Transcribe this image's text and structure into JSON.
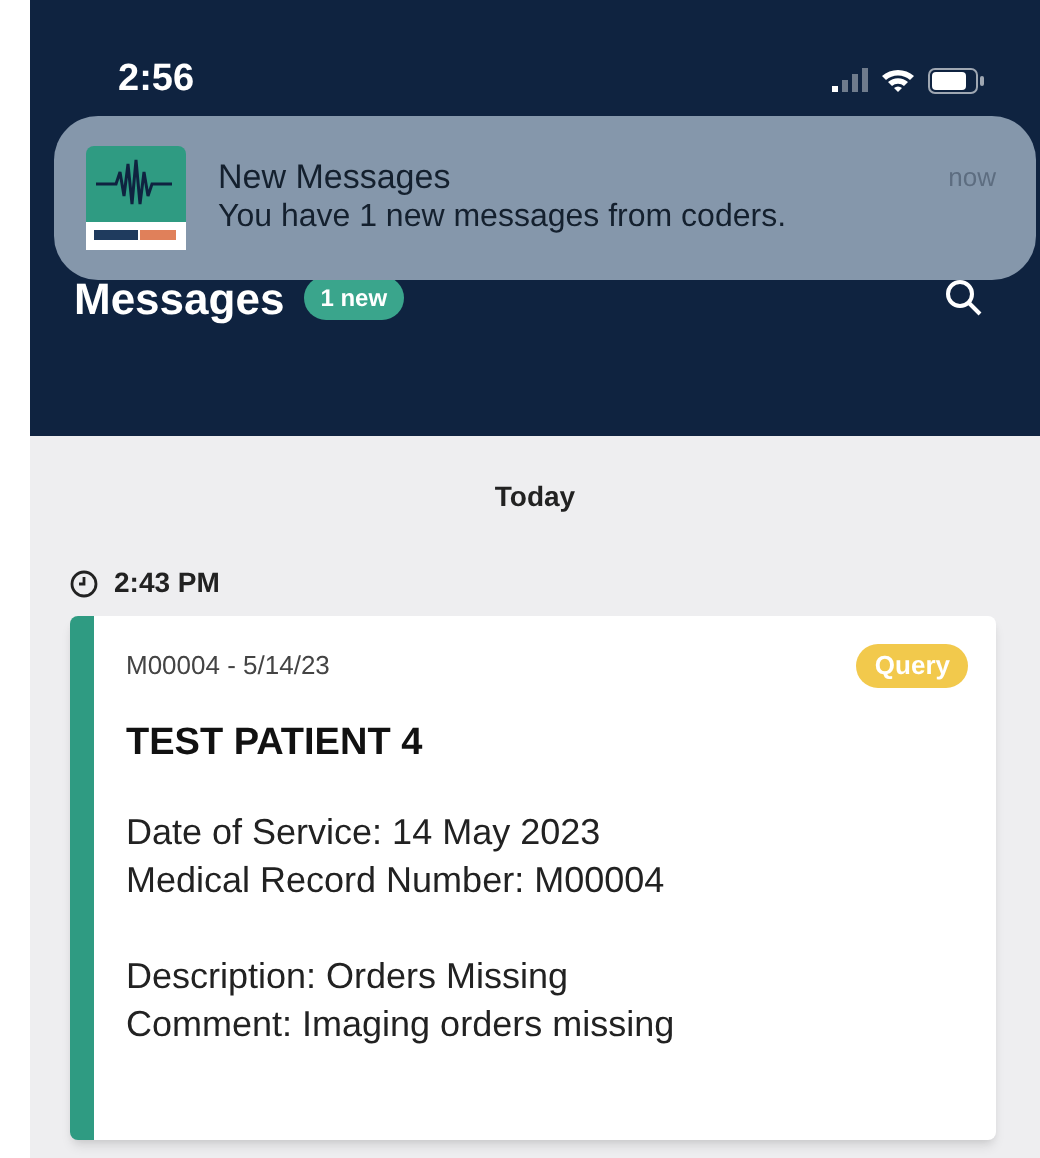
{
  "status_bar": {
    "time": "2:56"
  },
  "notification": {
    "title": "New Messages",
    "body": "You have 1 new messages from coders.",
    "time": "now"
  },
  "header": {
    "title": "Messages",
    "badge": "1 new"
  },
  "day": "Today",
  "messages": [
    {
      "time": "2:43 PM",
      "ref": "M00004 - 5/14/23",
      "tag": {
        "label": "Query",
        "color": "#f2c94c"
      },
      "patient": "TEST PATIENT 4",
      "lines": [
        "Date of Service: 14 May 2023",
        "Medical Record Number: M00004"
      ],
      "lines2": [
        "Description: Orders Missing",
        "Comment: Imaging orders missing"
      ]
    }
  ]
}
